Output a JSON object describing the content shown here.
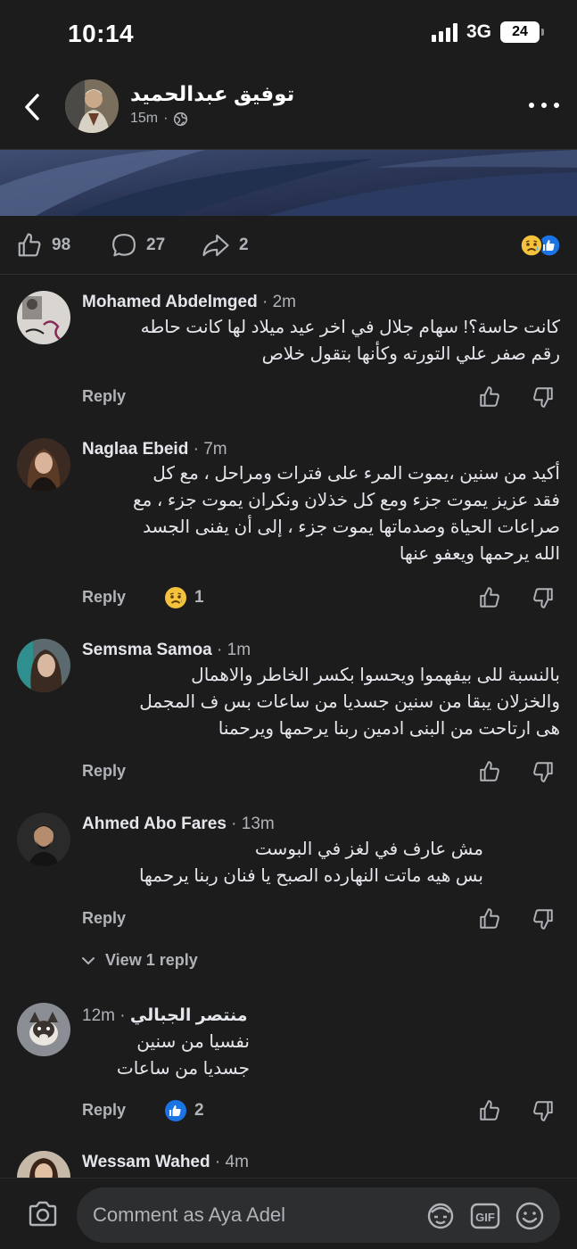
{
  "status": {
    "time": "10:14",
    "network": "3G",
    "battery": "24"
  },
  "header": {
    "title": "توفيق عبدالحميد",
    "time": "15m"
  },
  "actions": {
    "likes": "98",
    "comments": "27",
    "shares": "2"
  },
  "comments": [
    {
      "author": "Mohamed Abdelmged",
      "time": "2m",
      "lines": [
        "كانت حاسة؟! سهام جلال في اخر عيد ميلاد لها كانت حاطه",
        "رقم صفر علي التورته وكأنها بتقول خلاص"
      ]
    },
    {
      "author": "Naglaa Ebeid",
      "time": "7m",
      "lines": [
        "أكيد من سنين ،يموت المرء على فترات ومراحل ، مع كل",
        "فقد عزيز يموت جزء ومع كل خذلان ونكران يموت جزء ، مع",
        "صراعات الحياة وصدماتها يموت جزء ، إلى أن يفنى الجسد",
        "الله يرحمها ويعفو عنها"
      ],
      "reaction_count": "1"
    },
    {
      "author": "Semsma Samoa",
      "time": "1m",
      "lines": [
        "بالنسبة للى بيفهموا ويحسوا بكسر الخاطر والاهمال",
        "والخزلان يبقا من سنين جسديا من ساعات بس ف المجمل",
        "هى ارتاحت من البنى ادمين ربنا يرحمها ويرحمنا"
      ]
    },
    {
      "author": "Ahmed Abo Fares",
      "time": "13m",
      "lines": [
        "مش عارف في لغز في البوست",
        "بس هيه ماتت النهارده الصبح يا فنان ربنا يرحمها"
      ],
      "view_replies": "View 1 reply"
    },
    {
      "author": "منتصر الجبالي",
      "time": "12m",
      "lines": [
        "نفسيا من سنين",
        "جسديا من ساعات"
      ],
      "reaction_count": "2"
    },
    {
      "author": "Wessam Wahed",
      "time": "4m"
    }
  ],
  "labels": {
    "reply": "Reply"
  },
  "composer": {
    "placeholder": "Comment as Aya Adel",
    "gif": "GIF"
  }
}
